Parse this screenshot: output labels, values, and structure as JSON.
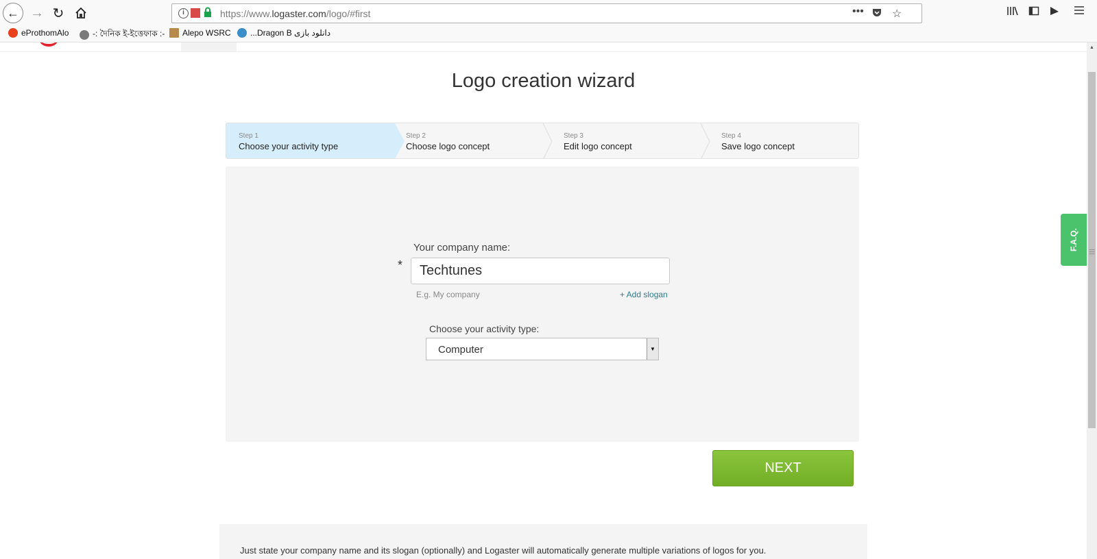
{
  "browser": {
    "url_prefix": "https://www.",
    "url_host": "logaster.com",
    "url_path": "/logo/#first",
    "bookmarks": [
      {
        "label": "eProthomAlo"
      },
      {
        "label": "-: দৈনিক ই-ইত্তেফাক :-"
      },
      {
        "label": "Alepo WSRC"
      },
      {
        "label": "...Dragon B دانلود بازی"
      }
    ]
  },
  "page": {
    "title": "Logo creation wizard",
    "steps": [
      {
        "num": "Step 1",
        "label": "Choose your activity type"
      },
      {
        "num": "Step 2",
        "label": "Choose logo concept"
      },
      {
        "num": "Step 3",
        "label": "Edit logo concept"
      },
      {
        "num": "Step 4",
        "label": "Save logo concept"
      }
    ],
    "form": {
      "company_label": "Your company name:",
      "required_mark": "*",
      "company_value": "Techtunes",
      "company_placeholder": "E.g. My company",
      "company_hint": "E.g. My company",
      "add_slogan": "+ Add slogan",
      "activity_label": "Choose your activity type:",
      "activity_value": "Computer"
    },
    "next_label": "NEXT",
    "info_text": "Just state your company name and its slogan (optionally) and Logaster will automatically generate multiple variations of logos for you.",
    "faq_label": "F.A.Q."
  },
  "colors": {
    "active_step": "#d6eefb",
    "next_button": "#7cb82f",
    "faq_tab": "#4bc26c",
    "link": "#2f7a8a"
  }
}
